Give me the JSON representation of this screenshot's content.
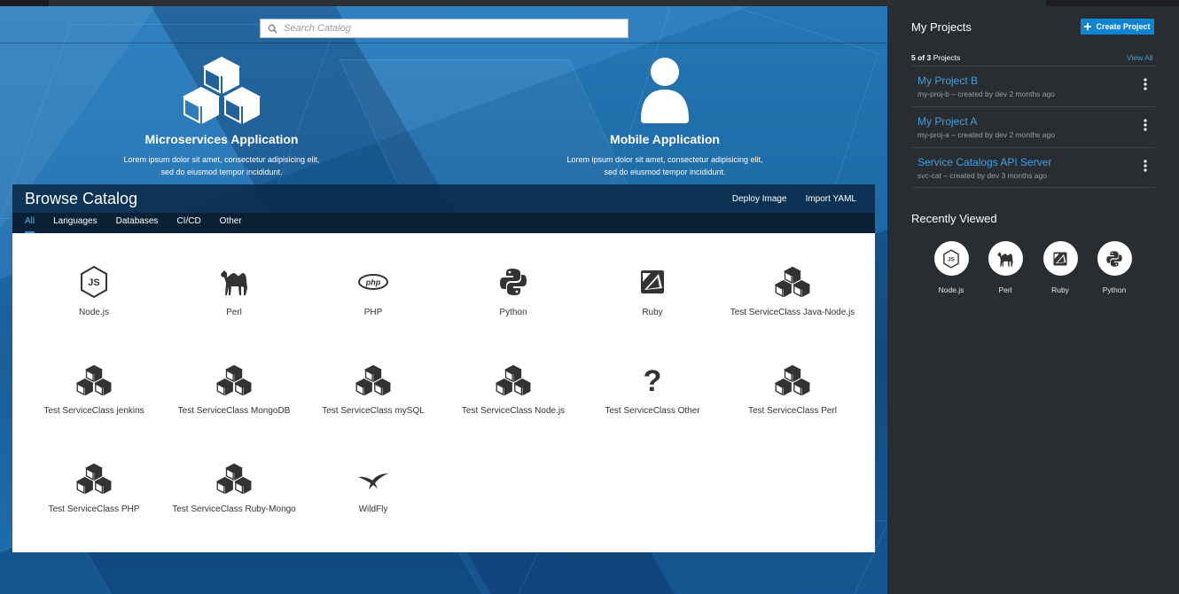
{
  "search": {
    "placeholder": "Search Catalog"
  },
  "hero": {
    "tiles": [
      {
        "title": "Microservices Application",
        "desc_line1": "Lorem ipsum dolor sit amet, consectetur adipisicing elit,",
        "desc_line2": "sed do eiusmod tempor incididunt.",
        "icon": "cubes-icon"
      },
      {
        "title": "Mobile Application",
        "desc_line1": "Lorem ipsum dolor sit amet, consectetur adipisicing elit,",
        "desc_line2": "sed do eiusmod tempor incididunt.",
        "icon": "user-icon"
      }
    ]
  },
  "catalog": {
    "title": "Browse Catalog",
    "actions": [
      "Deploy Image",
      "Import YAML"
    ],
    "tabs": [
      "All",
      "Languages",
      "Databases",
      "CI/CD",
      "Other"
    ],
    "active_tab": "All",
    "items": [
      {
        "label": "Node.js",
        "icon": "nodejs-icon"
      },
      {
        "label": "Perl",
        "icon": "perl-camel-icon"
      },
      {
        "label": "PHP",
        "icon": "php-icon"
      },
      {
        "label": "Python",
        "icon": "python-icon"
      },
      {
        "label": "Ruby",
        "icon": "ruby-icon"
      },
      {
        "label": "Test ServiceClass Java-Node.js",
        "icon": "cubes-icon"
      },
      {
        "label": "Test ServiceClass jenkins",
        "icon": "cubes-icon"
      },
      {
        "label": "Test ServiceClass MongoDB",
        "icon": "cubes-icon"
      },
      {
        "label": "Test ServiceClass mySQL",
        "icon": "cubes-icon"
      },
      {
        "label": "Test ServiceClass Node.js",
        "icon": "cubes-icon"
      },
      {
        "label": "Test ServiceClass Other",
        "icon": "question-icon"
      },
      {
        "label": "Test ServiceClass Perl",
        "icon": "cubes-icon"
      },
      {
        "label": "Test ServiceClass PHP",
        "icon": "cubes-icon"
      },
      {
        "label": "Test ServiceClass Ruby-Mongo",
        "icon": "cubes-icon"
      },
      {
        "label": "WildFly",
        "icon": "wildfly-icon"
      }
    ]
  },
  "sidebar": {
    "title": "My Projects",
    "create_label": "Create Project",
    "count_bold": "5 of 3",
    "count_suffix": " Projects",
    "view_all": "View All",
    "projects": [
      {
        "name": "My Project B",
        "meta": "my-proj-b – created by dev 2 months ago"
      },
      {
        "name": "My Project A",
        "meta": "my-proj-a – created by dev 2 months ago"
      },
      {
        "name": "Service Catalogs API Server",
        "meta": "svc-cat – created by dev 3 months ago"
      }
    ],
    "recent_title": "Recently Viewed",
    "recent": [
      {
        "label": "Node.js",
        "icon": "nodejs-icon"
      },
      {
        "label": "Perl",
        "icon": "perl-camel-icon"
      },
      {
        "label": "Ruby",
        "icon": "ruby-icon"
      },
      {
        "label": "Python",
        "icon": "python-icon"
      }
    ]
  },
  "colors": {
    "accent": "#0e84d1",
    "link": "#38a3e8",
    "sidebar_bg": "#292c31",
    "hero_blue": "#1d6aa6"
  }
}
